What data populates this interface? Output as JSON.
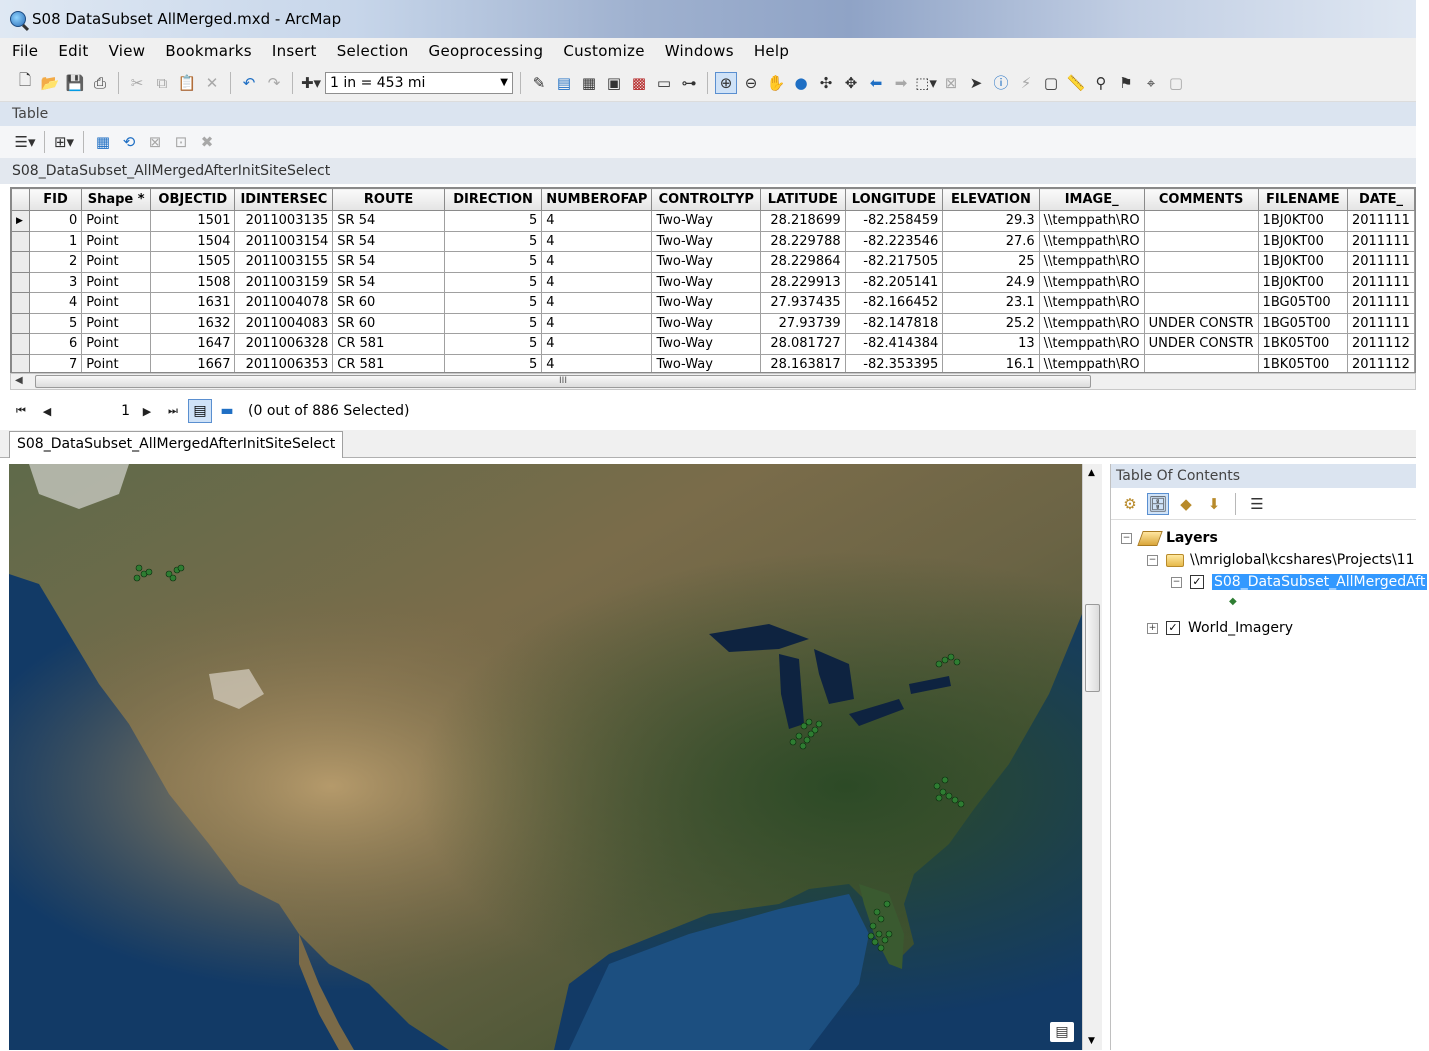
{
  "window": {
    "title": "S08 DataSubset AllMerged.mxd - ArcMap"
  },
  "menu": [
    "File",
    "Edit",
    "View",
    "Bookmarks",
    "Insert",
    "Selection",
    "Geoprocessing",
    "Customize",
    "Windows",
    "Help"
  ],
  "toolbar": {
    "scale_value": "1 in = 453 mi"
  },
  "table_panel": {
    "title": "Table",
    "table_name": "S08_DataSubset_AllMergedAfterInitSiteSelect",
    "columns": [
      "FID",
      "Shape *",
      "OBJECTID",
      "IDINTERSEC",
      "ROUTE",
      "DIRECTION",
      "NUMBEROFAP",
      "CONTROLTYP",
      "LATITUDE",
      "LONGITUDE",
      "ELEVATION",
      "IMAGE_",
      "COMMENTS",
      "FILENAME",
      "DATE_"
    ],
    "rows": [
      [
        "0",
        "Point",
        "1501",
        "2011003135",
        "SR 54",
        "5",
        "4",
        "Two-Way",
        "28.218699",
        "-82.258459",
        "29.3",
        "\\\\temppath\\RO",
        "",
        "1BJ0KT00",
        "2011111"
      ],
      [
        "1",
        "Point",
        "1504",
        "2011003154",
        "SR 54",
        "5",
        "4",
        "Two-Way",
        "28.229788",
        "-82.223546",
        "27.6",
        "\\\\temppath\\RO",
        "",
        "1BJ0KT00",
        "2011111"
      ],
      [
        "2",
        "Point",
        "1505",
        "2011003155",
        "SR 54",
        "5",
        "4",
        "Two-Way",
        "28.229864",
        "-82.217505",
        "25",
        "\\\\temppath\\RO",
        "",
        "1BJ0KT00",
        "2011111"
      ],
      [
        "3",
        "Point",
        "1508",
        "2011003159",
        "SR 54",
        "5",
        "4",
        "Two-Way",
        "28.229913",
        "-82.205141",
        "24.9",
        "\\\\temppath\\RO",
        "",
        "1BJ0KT00",
        "2011111"
      ],
      [
        "4",
        "Point",
        "1631",
        "2011004078",
        "SR 60",
        "5",
        "4",
        "Two-Way",
        "27.937435",
        "-82.166452",
        "23.1",
        "\\\\temppath\\RO",
        "",
        "1BG05T00",
        "2011111"
      ],
      [
        "5",
        "Point",
        "1632",
        "2011004083",
        "SR 60",
        "5",
        "4",
        "Two-Way",
        "27.93739",
        "-82.147818",
        "25.2",
        "\\\\temppath\\RO",
        "UNDER CONSTR",
        "1BG05T00",
        "2011111"
      ],
      [
        "6",
        "Point",
        "1647",
        "2011006328",
        "CR 581",
        "5",
        "4",
        "Two-Way",
        "28.081727",
        "-82.414384",
        "13",
        "\\\\temppath\\RO",
        "UNDER CONSTR",
        "1BK05T00",
        "2011112"
      ],
      [
        "7",
        "Point",
        "1667",
        "2011006353",
        "CR 581",
        "5",
        "4",
        "Two-Way",
        "28.163817",
        "-82.353395",
        "16.1",
        "\\\\temppath\\RO",
        "",
        "1BK05T00",
        "2011112"
      ]
    ],
    "scroll_glyph": "III",
    "nav": {
      "current_record": "1",
      "selection_status": "(0 out of 886 Selected)"
    },
    "tab_label": "S08_DataSubset_AllMergedAfterInitSiteSelect"
  },
  "toc": {
    "title": "Table Of Contents",
    "layers_label": "Layers",
    "group_path": "\\\\mriglobal\\kcshares\\Projects\\11",
    "selected_layer": "S08_DataSubset_AllMergedAft",
    "imagery_layer": "World_Imagery"
  },
  "colors": {
    "selection_highlight": "#3399ff",
    "point_symbol": "#2e7d32",
    "panel_header": "#dbe4f0"
  }
}
